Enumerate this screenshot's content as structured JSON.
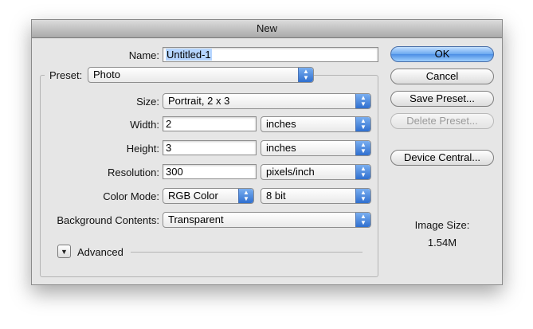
{
  "window": {
    "title": "New"
  },
  "form": {
    "name_label": "Name:",
    "name_value": "Untitled-1",
    "preset_label": "Preset:",
    "preset_value": "Photo",
    "size_label": "Size:",
    "size_value": "Portrait, 2 x 3",
    "width_label": "Width:",
    "width_value": "2",
    "width_unit": "inches",
    "height_label": "Height:",
    "height_value": "3",
    "height_unit": "inches",
    "resolution_label": "Resolution:",
    "resolution_value": "300",
    "resolution_unit": "pixels/inch",
    "color_mode_label": "Color Mode:",
    "color_mode_value": "RGB Color",
    "bit_depth_value": "8 bit",
    "background_label": "Background Contents:",
    "background_value": "Transparent",
    "advanced_label": "Advanced"
  },
  "buttons": {
    "ok": "OK",
    "cancel": "Cancel",
    "save_preset": "Save Preset...",
    "delete_preset": "Delete Preset...",
    "device_central": "Device Central..."
  },
  "info": {
    "image_size_label": "Image Size:",
    "image_size_value": "1.54M"
  }
}
